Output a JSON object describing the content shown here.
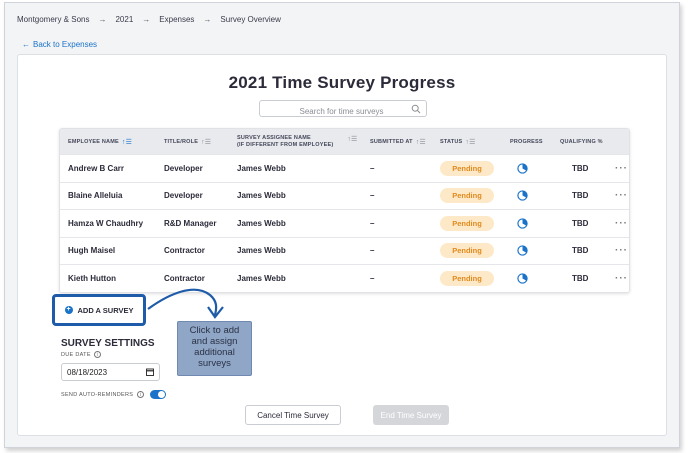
{
  "breadcrumb": {
    "items": [
      "Montgomery & Sons",
      "2021",
      "Expenses",
      "Survey Overview"
    ],
    "separator": "→"
  },
  "back_link": {
    "arrow": "←",
    "label": "Back to Expenses"
  },
  "page_title": "2021 Time Survey Progress",
  "search": {
    "placeholder": "Search for time surveys",
    "icon": "search-icon"
  },
  "table": {
    "headers": {
      "employee_name": "EMPLOYEE NAME",
      "title_role": "TITLE/ROLE",
      "assignee_line1": "SURVEY ASSIGNEE NAME",
      "assignee_line2": "(IF DIFFERENT FROM EMPLOYEE)",
      "submitted_at": "SUBMITTED AT",
      "status": "STATUS",
      "progress": "PROGRESS",
      "qualifying": "QUALIFYING %"
    },
    "rows": [
      {
        "name": "Andrew B Carr",
        "title": "Developer",
        "assignee": "James Webb",
        "submitted": "–",
        "status": "Pending",
        "qualifying": "TBD",
        "more": "···"
      },
      {
        "name": "Blaine Alleluia",
        "title": "Developer",
        "assignee": "James Webb",
        "submitted": "–",
        "status": "Pending",
        "qualifying": "TBD",
        "more": "···"
      },
      {
        "name": "Hamza W Chaudhry",
        "title": "R&D Manager",
        "assignee": "James Webb",
        "submitted": "–",
        "status": "Pending",
        "qualifying": "TBD",
        "more": "···"
      },
      {
        "name": "Hugh Maisel",
        "title": "Contractor",
        "assignee": "James Webb",
        "submitted": "–",
        "status": "Pending",
        "qualifying": "TBD",
        "more": "···"
      },
      {
        "name": "Kieth Hutton",
        "title": "Contractor",
        "assignee": "James Webb",
        "submitted": "–",
        "status": "Pending",
        "qualifying": "TBD",
        "more": "···"
      }
    ]
  },
  "add_survey": {
    "label": "ADD A SURVEY",
    "icon": "plus-circle-icon"
  },
  "callout": {
    "line1": "Click to add",
    "line2": "and assign",
    "line3": "additional",
    "line4": "surveys"
  },
  "settings": {
    "title": "SURVEY SETTINGS",
    "due_label": "DUE DATE",
    "due_value": "08/18/2023",
    "auto_reminders_label": "SEND AUTO-REMINDERS",
    "auto_reminders_on": true
  },
  "actions": {
    "cancel": "Cancel Time Survey",
    "end": "End Time Survey"
  },
  "colors": {
    "accent": "#1a73c8",
    "pending_bg": "#fde9c8",
    "pending_text": "#e08b1e",
    "callout_bg": "#8fa6c7",
    "highlight_border": "#1e5ba8"
  }
}
